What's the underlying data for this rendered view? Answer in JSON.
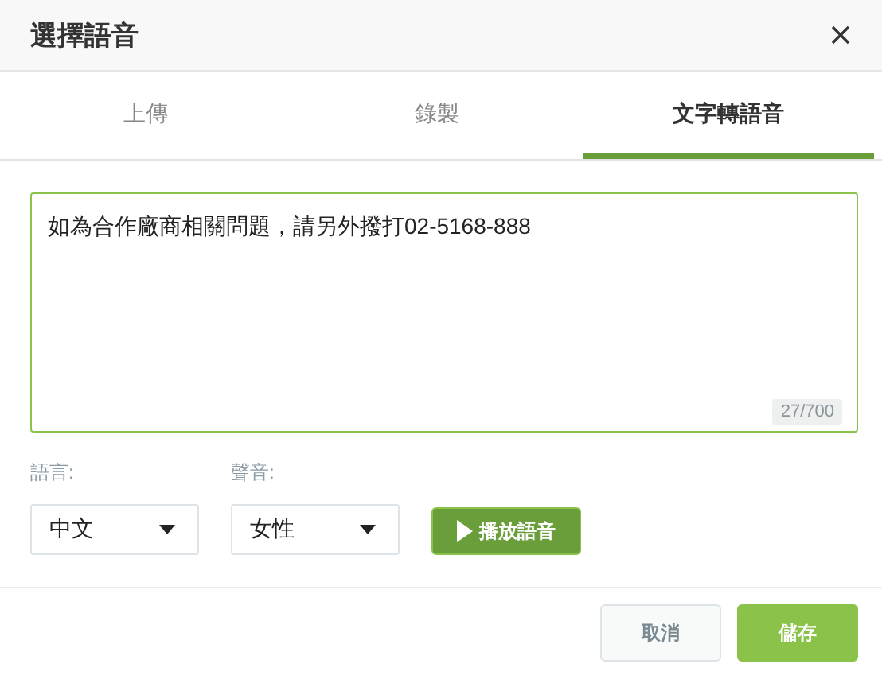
{
  "dialog": {
    "title": "選擇語音"
  },
  "tabs": [
    {
      "label": "上傳",
      "selected": false
    },
    {
      "label": "錄製",
      "selected": false
    },
    {
      "label": "文字轉語音",
      "selected": true
    }
  ],
  "text_area": {
    "value": "如為合作廠商相關問題，請另外撥打02-5168-888",
    "counter": "27/700"
  },
  "language": {
    "label": "語言:",
    "value": "中文"
  },
  "voice": {
    "label": "聲音:",
    "value": "女性"
  },
  "play_button": "播放語音",
  "buttons": [
    {
      "label": "取消",
      "kind": "secondary"
    },
    {
      "label": "儲存",
      "kind": "primary"
    }
  ]
}
